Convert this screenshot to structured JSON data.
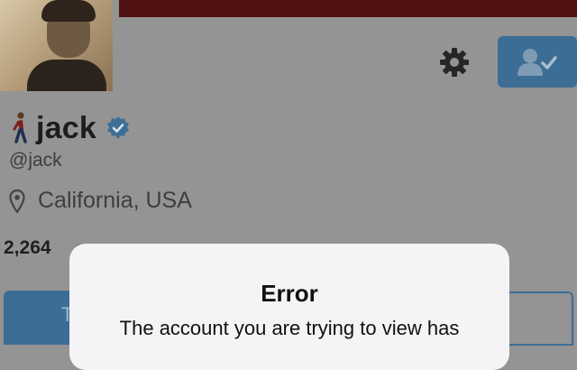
{
  "profile": {
    "name": "jack",
    "handle": "@jack",
    "location": "California, USA",
    "following_count": "2,264",
    "verified": true,
    "banner_color": "#4f1112"
  },
  "actions": {
    "settings_icon": "gear-icon",
    "follow_icon": "person-check-icon"
  },
  "tabs": {
    "left_partial": "T"
  },
  "alert": {
    "title": "Error",
    "message": "The account you are trying to view has"
  },
  "colors": {
    "accent": "#3c6d94",
    "overlay": "#949494",
    "dialog_bg": "#f4f4f6"
  }
}
